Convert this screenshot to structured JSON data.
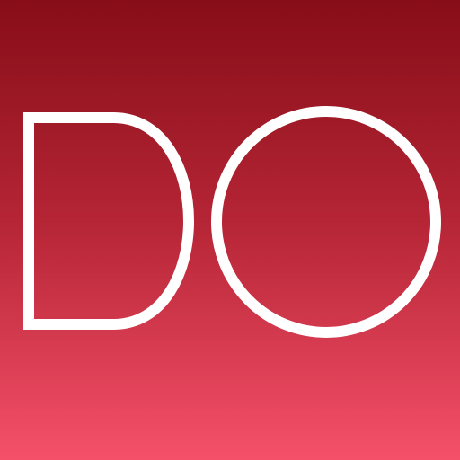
{
  "app_icon": {
    "logo_text": "DO",
    "background_top_color": "#870d18",
    "background_mid_color": "#b52535",
    "background_bottom_color": "#f5506a",
    "text_color": "#ffffff"
  }
}
